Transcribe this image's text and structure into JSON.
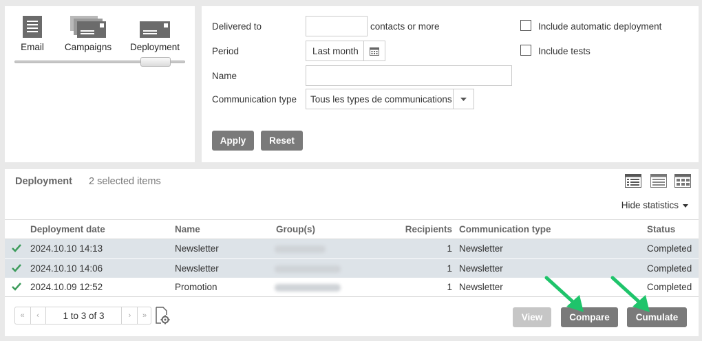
{
  "view_types": {
    "email_label": "Email",
    "campaigns_label": "Campaigns",
    "deployment_label": "Deployment",
    "selected": "Deployment"
  },
  "filters": {
    "delivered_to_label": "Delivered to",
    "delivered_to_value": "",
    "delivered_to_suffix": "contacts or more",
    "period_label": "Period",
    "period_value": "Last month",
    "name_label": "Name",
    "name_value": "",
    "communication_type_label": "Communication type",
    "communication_type_value": "Tous les types de communications",
    "include_automatic_label": "Include automatic deployment",
    "include_tests_label": "Include tests",
    "include_automatic_checked": false,
    "include_tests_checked": false,
    "apply_label": "Apply",
    "reset_label": "Reset"
  },
  "results": {
    "title": "Deployment",
    "selected_count": "2 selected items",
    "hide_statistics_label": "Hide statistics",
    "columns": {
      "date": "Deployment date",
      "name": "Name",
      "groups": "Group(s)",
      "recipients": "Recipients",
      "comm_type": "Communication type",
      "status": "Status"
    },
    "rows": [
      {
        "selected": true,
        "date": "2024.10.10 14:13",
        "name": "Newsletter",
        "recipients": "1",
        "comm_type": "Newsletter",
        "status": "Completed"
      },
      {
        "selected": true,
        "date": "2024.10.10 14:06",
        "name": "Newsletter",
        "recipients": "1",
        "comm_type": "Newsletter",
        "status": "Completed"
      },
      {
        "selected": false,
        "date": "2024.10.09 12:52",
        "name": "Promotion",
        "recipients": "1",
        "comm_type": "Newsletter",
        "status": "Completed"
      }
    ],
    "pager_text": "1 to 3 of 3",
    "view_label": "View",
    "compare_label": "Compare",
    "cumulate_label": "Cumulate"
  },
  "colors": {
    "selected_row": "#dde3e8",
    "button_dark": "#7a7a7a",
    "button_disabled": "#c6c6c6",
    "check_green": "#3d9c5c",
    "annotation_arrow": "#1fc46b"
  }
}
